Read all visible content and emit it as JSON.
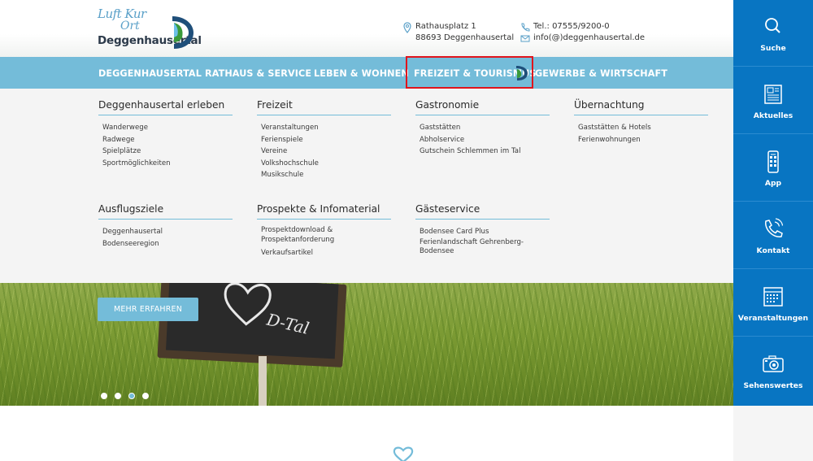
{
  "logo": {
    "script_line1": "Luft Kur",
    "script_line2": "Ort",
    "name": "Deggenhausertal"
  },
  "contact": {
    "address_line1": "Rathausplatz 1",
    "address_line2": "88693 Deggenhausertal",
    "phone": "Tel.: 07555/9200-0",
    "email": "info(@)deggenhausertal.de"
  },
  "nav": {
    "items": [
      {
        "label": "DEGGENHAUSERTAL"
      },
      {
        "label": "RATHAUS & SERVICE"
      },
      {
        "label": "LEBEN & WOHNEN"
      },
      {
        "label": "FREIZEIT & TOURISMUS"
      },
      {
        "label": "GEWERBE & WIRTSCHAFT"
      }
    ],
    "active_index": 3
  },
  "mega": {
    "columns": [
      {
        "title": "Deggenhausertal erleben",
        "links": [
          "Wanderwege",
          "Radwege",
          "Spielplätze",
          "Sportmöglichkeiten"
        ]
      },
      {
        "title": "Freizeit",
        "links": [
          "Veranstaltungen",
          "Ferienspiele",
          "Vereine",
          "Volkshochschule",
          "Musikschule"
        ]
      },
      {
        "title": "Gastronomie",
        "links": [
          "Gaststätten",
          "Abholservice",
          "Gutschein Schlemmen im Tal"
        ]
      },
      {
        "title": "Übernachtung",
        "links": [
          "Gaststätten & Hotels",
          "Ferienwohnungen"
        ]
      },
      {
        "title": "Ausflugsziele",
        "links": [
          "Deggenhausertal",
          "Bodenseeregion"
        ]
      },
      {
        "title": "Prospekte & Infomaterial",
        "links": [
          "Prospektdownload & Prospektanforderung",
          "Verkaufsartikel"
        ]
      },
      {
        "title": "Gästeservice",
        "links": [
          "Bodensee Card Plus",
          "Ferienlandschaft Gehrenberg-Bodensee"
        ]
      }
    ]
  },
  "hero": {
    "button_label": "MEHR ERFAHREN",
    "chalkboard_text": "D-Tal",
    "slides_count": 4,
    "active_slide": 2
  },
  "sidebar": {
    "items": [
      {
        "label": "Suche",
        "icon": "search-icon"
      },
      {
        "label": "Aktuelles",
        "icon": "newspaper-icon"
      },
      {
        "label": "App",
        "icon": "smartphone-icon"
      },
      {
        "label": "Kontakt",
        "icon": "phone-icon"
      },
      {
        "label": "Veranstaltungen",
        "icon": "calendar-icon"
      },
      {
        "label": "Sehenswertes",
        "icon": "camera-icon"
      }
    ]
  },
  "colors": {
    "nav_blue": "#74bcd9",
    "sidebar_blue": "#0875c2",
    "highlight_red": "#e0141c",
    "menu_bg": "#f4f4f4"
  }
}
